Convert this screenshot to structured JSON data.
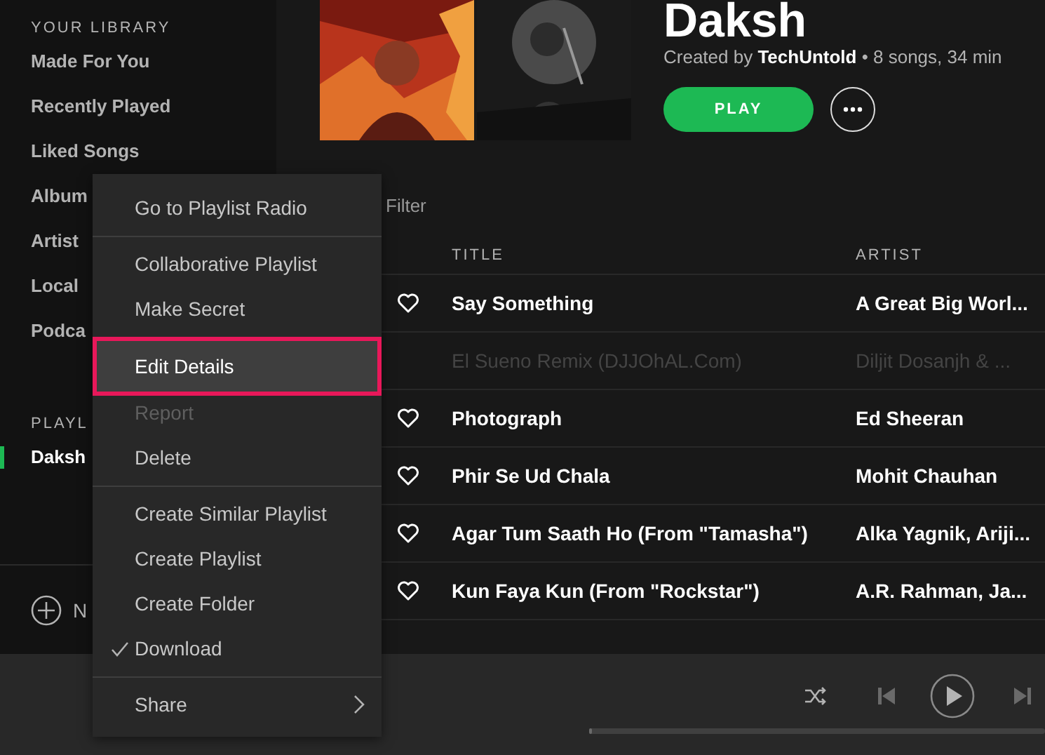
{
  "sidebar": {
    "library_heading": "YOUR LIBRARY",
    "library_items": [
      {
        "label": "Made For You",
        "selected": false
      },
      {
        "label": "Recently Played",
        "selected": false
      },
      {
        "label": "Liked Songs",
        "selected": false
      },
      {
        "label": "Album",
        "selected": false
      },
      {
        "label": "Artist",
        "selected": false
      },
      {
        "label": "Local",
        "selected": false
      },
      {
        "label": "Podca",
        "selected": false
      }
    ],
    "playlists_heading": "PLAYL",
    "playlists": [
      {
        "label": "Daksh",
        "selected": true
      }
    ],
    "new_playlist_label": "N"
  },
  "playlist": {
    "title": "Daksh",
    "meta": "Created by **TechUntold** • 8 songs, 34 min",
    "play_button": "PLAY",
    "filter": {
      "placeholder": "Filter"
    }
  },
  "player": {
    "progress": {
      "level": 0
    }
  },
  "table": {
    "columns": [
      "TITLE",
      "ARTIST"
    ],
    "rows": [
      {
        "title": "Say Something",
        "artist": "A Great Big Worl...",
        "available": true
      },
      {
        "title": "El Sueno Remix (DJJOhAL.Com)",
        "artist": "Diljit Dosanjh & ...",
        "available": false
      },
      {
        "title": "Photograph",
        "artist": "Ed Sheeran",
        "available": true
      },
      {
        "title": "Phir Se Ud Chala",
        "artist": "Mohit Chauhan",
        "available": true
      },
      {
        "title": "Agar Tum Saath Ho (From \"Tamasha\")",
        "artist": "Alka Yagnik, Ariji...",
        "available": true
      },
      {
        "title": "Kun Faya Kun (From \"Rockstar\")",
        "artist": "A.R. Rahman, Ja...",
        "available": true
      }
    ]
  },
  "context_menu": {
    "groups": [
      [
        {
          "label": "Go to Playlist Radio",
          "highlighted": false,
          "disabled": false,
          "checked": false,
          "submenu": false
        }
      ],
      [
        {
          "label": "Collaborative Playlist",
          "highlighted": false,
          "disabled": false,
          "checked": false,
          "submenu": false
        },
        {
          "label": "Make Secret",
          "highlighted": false,
          "disabled": false,
          "checked": false,
          "submenu": false
        },
        {
          "label": "Edit Details",
          "highlighted": true,
          "disabled": false,
          "checked": false,
          "submenu": false
        },
        {
          "label": "Report",
          "highlighted": false,
          "disabled": true,
          "checked": false,
          "submenu": false
        },
        {
          "label": "Delete",
          "highlighted": false,
          "disabled": false,
          "checked": false,
          "submenu": false
        }
      ],
      [
        {
          "label": "Create Similar Playlist",
          "highlighted": false,
          "disabled": false,
          "checked": false,
          "submenu": false
        },
        {
          "label": "Create Playlist",
          "highlighted": false,
          "disabled": false,
          "checked": false,
          "submenu": false
        },
        {
          "label": "Create Folder",
          "highlighted": false,
          "disabled": false,
          "checked": false,
          "submenu": false
        },
        {
          "label": "Download",
          "highlighted": false,
          "disabled": false,
          "checked": true,
          "submenu": false
        }
      ],
      [
        {
          "label": "Share",
          "highlighted": false,
          "disabled": false,
          "checked": false,
          "submenu": true
        }
      ]
    ]
  }
}
